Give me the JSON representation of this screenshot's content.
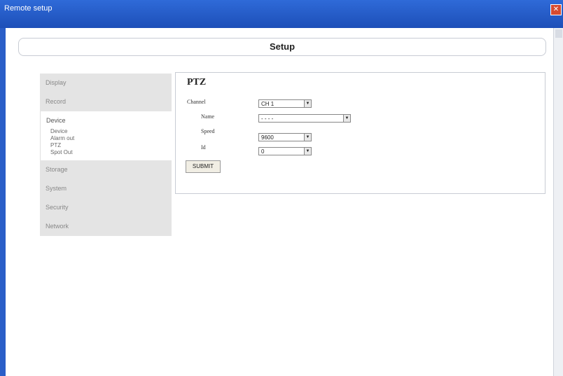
{
  "window": {
    "title": "Remote setup",
    "close_glyph": "✕"
  },
  "header": {
    "title": "Setup"
  },
  "sidebar": {
    "items": [
      {
        "label": "Display"
      },
      {
        "label": "Record"
      },
      {
        "label": "Device",
        "subitems": [
          "Device",
          "Alarm out",
          "PTZ",
          "Spot Out"
        ]
      },
      {
        "label": "Storage"
      },
      {
        "label": "System"
      },
      {
        "label": "Security"
      },
      {
        "label": "Network"
      }
    ]
  },
  "panel": {
    "title": "PTZ",
    "fields": {
      "channel": {
        "label": "Channel",
        "value": "CH 1"
      },
      "name": {
        "label": "Name",
        "value": "- - - -"
      },
      "speed": {
        "label": "Speed",
        "value": "9600"
      },
      "id": {
        "label": "Id",
        "value": "0"
      }
    },
    "submit_label": "SUBMIT"
  },
  "icons": {
    "close": "close-icon",
    "dropdown": "chevron-down-icon"
  },
  "colors": {
    "titlebar": "#1d4fb8",
    "close_button": "#d64b2f",
    "nav_background": "#e4e4e4",
    "active_nav_background": "#ffffff"
  }
}
